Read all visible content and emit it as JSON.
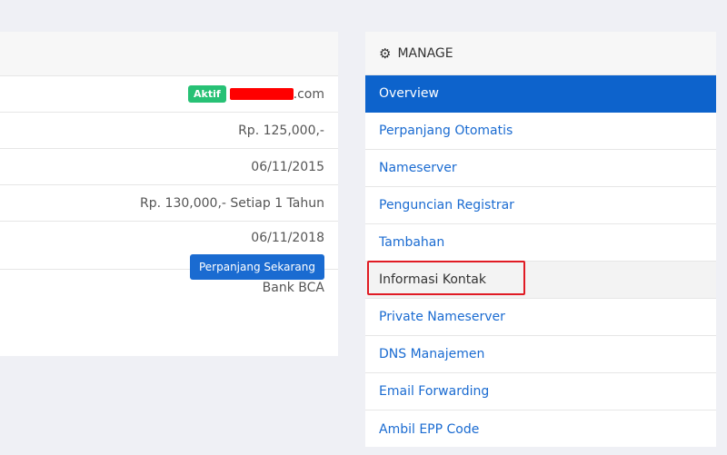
{
  "details": {
    "status_badge": "Aktif",
    "domain_suffix": ".com",
    "rows": [
      {
        "value": "Rp. 125,000,-"
      },
      {
        "value": "06/11/2015"
      },
      {
        "value": "Rp. 130,000,- Setiap 1 Tahun"
      },
      {
        "value": "06/11/2018"
      },
      {
        "value": "Bank BCA"
      }
    ],
    "renew_button": "Perpanjang Sekarang"
  },
  "manage": {
    "title": "MANAGE",
    "items": [
      {
        "label": "Overview"
      },
      {
        "label": "Perpanjang Otomatis"
      },
      {
        "label": "Nameserver"
      },
      {
        "label": "Penguncian Registrar"
      },
      {
        "label": "Tambahan"
      },
      {
        "label": "Informasi Kontak"
      },
      {
        "label": "Private Nameserver"
      },
      {
        "label": "DNS Manajemen"
      },
      {
        "label": "Email Forwarding"
      },
      {
        "label": "Ambil EPP Code"
      }
    ]
  },
  "colors": {
    "accent": "#0d63cc",
    "badge": "#27c175",
    "highlight": "#e01b24"
  }
}
